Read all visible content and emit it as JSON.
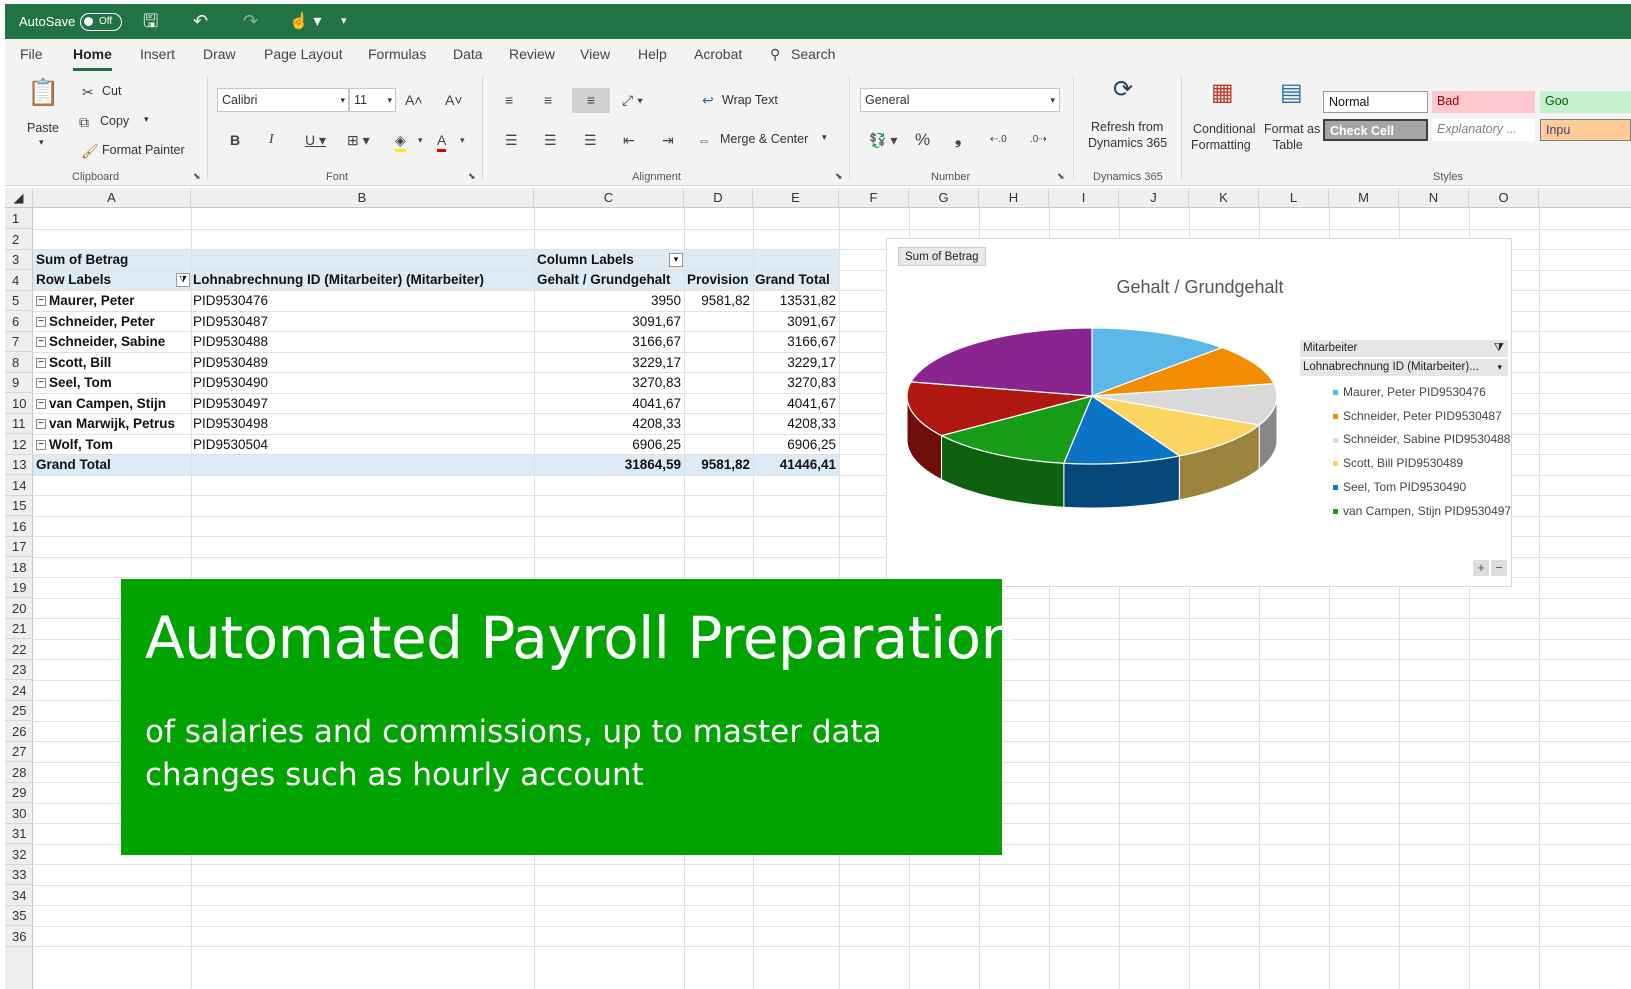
{
  "titlebar": {
    "autosave_label": "AutoSave",
    "autosave_state": "Off"
  },
  "menu": {
    "items": [
      "File",
      "Home",
      "Insert",
      "Draw",
      "Page Layout",
      "Formulas",
      "Data",
      "Review",
      "View",
      "Help",
      "Acrobat"
    ],
    "search": "Search"
  },
  "ribbon": {
    "clipboard": {
      "paste": "Paste",
      "cut": "Cut",
      "copy": "Copy",
      "format_painter": "Format Painter",
      "group": "Clipboard"
    },
    "font": {
      "name": "Calibri",
      "size": "11",
      "group": "Font"
    },
    "alignment": {
      "wrap": "Wrap Text",
      "merge": "Merge & Center",
      "group": "Alignment"
    },
    "number": {
      "format": "General",
      "group": "Number"
    },
    "dynamics": {
      "refresh_line1": "Refresh from",
      "refresh_line2": "Dynamics 365",
      "group": "Dynamics 365"
    },
    "styles": {
      "cond_line1": "Conditional",
      "cond_line2": "Formatting",
      "fmt_line1": "Format as",
      "fmt_line2": "Table",
      "normal": "Normal",
      "bad": "Bad",
      "good": "Goo",
      "check": "Check Cell",
      "explanatory": "Explanatory ...",
      "input": "Inpu",
      "group": "Styles"
    }
  },
  "columns": [
    "A",
    "B",
    "C",
    "D",
    "E",
    "F",
    "G",
    "H",
    "I",
    "J",
    "K",
    "L",
    "M",
    "N",
    "O"
  ],
  "rows": [
    "1",
    "2",
    "3",
    "4",
    "5",
    "6",
    "7",
    "8",
    "9",
    "10",
    "11",
    "12",
    "13",
    "14",
    "15",
    "16",
    "17",
    "18",
    "19",
    "20",
    "21",
    "22",
    "23",
    "24",
    "25",
    "26",
    "27",
    "28",
    "29",
    "30",
    "31",
    "32",
    "33",
    "34",
    "35",
    "36"
  ],
  "pivot": {
    "sum_label": "Sum of Betrag",
    "col_labels": "Column Labels",
    "row_labels": "Row Labels",
    "id_header": "Lohnabrechnung ID (Mitarbeiter) (Mitarbeiter)",
    "h_gehalt": "Gehalt / Grundgehalt",
    "h_provision": "Provision",
    "h_total": "Grand Total",
    "rows": [
      {
        "name": "Maurer, Peter",
        "id": "PID9530476",
        "gehalt": "3950",
        "provision": "9581,82",
        "total": "13531,82"
      },
      {
        "name": "Schneider, Peter",
        "id": "PID9530487",
        "gehalt": "3091,67",
        "provision": "",
        "total": "3091,67"
      },
      {
        "name": "Schneider, Sabine",
        "id": "PID9530488",
        "gehalt": "3166,67",
        "provision": "",
        "total": "3166,67"
      },
      {
        "name": "Scott, Bill",
        "id": "PID9530489",
        "gehalt": "3229,17",
        "provision": "",
        "total": "3229,17"
      },
      {
        "name": "Seel, Tom",
        "id": "PID9530490",
        "gehalt": "3270,83",
        "provision": "",
        "total": "3270,83"
      },
      {
        "name": "van Campen, Stijn",
        "id": "PID9530497",
        "gehalt": "4041,67",
        "provision": "",
        "total": "4041,67"
      },
      {
        "name": "van Marwijk, Petrus",
        "id": "PID9530498",
        "gehalt": "4208,33",
        "provision": "",
        "total": "4208,33"
      },
      {
        "name": "Wolf, Tom",
        "id": "PID9530504",
        "gehalt": "6906,25",
        "provision": "",
        "total": "6906,25"
      }
    ],
    "grand_label": "Grand Total",
    "grand_gehalt": "31864,59",
    "grand_provision": "9581,82",
    "grand_total": "41446,41"
  },
  "chart": {
    "field_button": "Sum of Betrag",
    "filter_label": "Mitarbeiter",
    "filter_field": "Lohnabrechnung ID (Mitarbeiter)..."
  },
  "chart_data": {
    "type": "pie",
    "title": "Gehalt / Grundgehalt",
    "categories": [
      "Maurer, Peter PID9530476",
      "Schneider, Peter PID9530487",
      "Schneider, Sabine PID9530488",
      "Scott, Bill PID9530489",
      "Seel, Tom PID9530490",
      "van Campen, Stijn PID9530497",
      "van Marwijk, Petrus PID9530498",
      "Wolf, Tom PID9530504"
    ],
    "legend_visible": [
      "Maurer, Peter PID9530476",
      "Schneider, Peter PID9530487",
      "Schneider, Sabine PID9530488",
      "Scott, Bill PID9530489",
      "Seel, Tom PID9530490",
      "van Campen, Stijn PID9530497"
    ],
    "values": [
      3950,
      3091.67,
      3166.67,
      3229.17,
      3270.83,
      4041.67,
      4208.33,
      6906.25
    ],
    "colors": [
      "#5bb8e8",
      "#f28c00",
      "#d9d9d9",
      "#fcd462",
      "#0b74c6",
      "#169c16",
      "#b01710",
      "#8a258f"
    ],
    "legend_position": "right"
  },
  "overlay": {
    "title": "Automated Payroll Preparation",
    "subtitle": "of salaries and commissions, up to master data changes such as hourly account"
  }
}
